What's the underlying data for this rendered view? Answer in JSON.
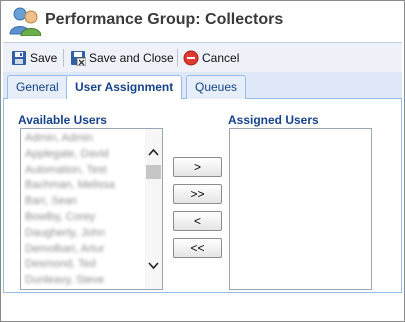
{
  "window": {
    "title": "Performance Group: Collectors"
  },
  "toolbar": {
    "save_label": "Save",
    "save_close_label": "Save and Close",
    "cancel_label": "Cancel"
  },
  "tabs": [
    {
      "label": "General",
      "active": false
    },
    {
      "label": "User Assignment",
      "active": true
    },
    {
      "label": "Queues",
      "active": false
    }
  ],
  "available_users": {
    "label": "Available Users",
    "items": [
      "Admin, Admin",
      "Applegate, David",
      "Automation, Test",
      "Bachman, Melissa",
      "Barr, Sean",
      "Bowlby, Corey",
      "Daugherty, John",
      "Demolbari, Artur",
      "Desmond, Ted",
      "Dunleavy, Steve"
    ]
  },
  "assigned_users": {
    "label": "Assigned Users",
    "items": []
  },
  "move_buttons": {
    "add_one": ">",
    "add_all": ">>",
    "remove_one": "<",
    "remove_all": "<<"
  },
  "colors": {
    "tab_text": "#15428b",
    "toolbar_bg": "#eef2f8",
    "tab_strip_bg": "#dfe8f6",
    "border_blue": "#99bbe8"
  },
  "icons": {
    "title": "users-group-icon",
    "save": "floppy-disk-icon",
    "save_close": "floppy-disk-close-icon",
    "cancel": "cancel-circle-icon"
  }
}
